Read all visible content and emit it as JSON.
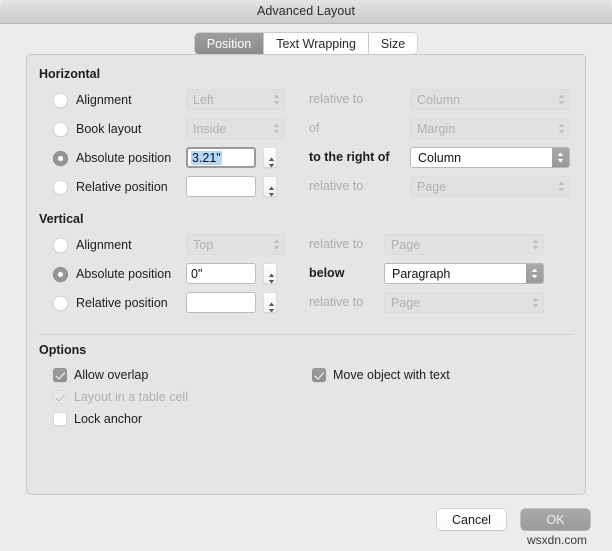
{
  "window": {
    "title": "Advanced Layout"
  },
  "tabs": [
    {
      "label": "Position",
      "selected": true
    },
    {
      "label": "Text Wrapping",
      "selected": false
    },
    {
      "label": "Size",
      "selected": false
    }
  ],
  "horizontal": {
    "title": "Horizontal",
    "rows": [
      {
        "radio_label": "Alignment",
        "selected": false,
        "control_type": "combo",
        "control_value": "Left",
        "control_enabled": false,
        "mid_label": "relative to",
        "mid_active": false,
        "right_value": "Column",
        "right_enabled": false
      },
      {
        "radio_label": "Book layout",
        "selected": false,
        "control_type": "combo",
        "control_value": "Inside",
        "control_enabled": false,
        "mid_label": "of",
        "mid_active": false,
        "right_value": "Margin",
        "right_enabled": false
      },
      {
        "radio_label": "Absolute position",
        "selected": true,
        "control_type": "text",
        "control_value": "3.21\"",
        "control_enabled": true,
        "mid_label": "to the right of",
        "mid_active": true,
        "right_value": "Column",
        "right_enabled": true
      },
      {
        "radio_label": "Relative position",
        "selected": false,
        "control_type": "text",
        "control_value": "",
        "control_enabled": true,
        "mid_label": "relative to",
        "mid_active": false,
        "right_value": "Page",
        "right_enabled": false
      }
    ]
  },
  "vertical": {
    "title": "Vertical",
    "rows": [
      {
        "radio_label": "Alignment",
        "selected": false,
        "control_type": "combo",
        "control_value": "Top",
        "control_enabled": false,
        "mid_label": "relative to",
        "mid_active": false,
        "right_value": "Page",
        "right_enabled": false
      },
      {
        "radio_label": "Absolute position",
        "selected": true,
        "control_type": "text",
        "control_value": "0\"",
        "control_enabled": true,
        "mid_label": "below",
        "mid_active": true,
        "right_value": "Paragraph",
        "right_enabled": true
      },
      {
        "radio_label": "Relative position",
        "selected": false,
        "control_type": "text",
        "control_value": "",
        "control_enabled": true,
        "mid_label": "relative to",
        "mid_active": false,
        "right_value": "Page",
        "right_enabled": false
      }
    ]
  },
  "options": {
    "title": "Options",
    "left_column": [
      {
        "label": "Allow overlap",
        "checked": true,
        "enabled": true
      },
      {
        "label": "Layout in a table cell",
        "checked": true,
        "enabled": false
      },
      {
        "label": "Lock anchor",
        "checked": false,
        "enabled": true
      }
    ],
    "right_column": [
      {
        "label": "Move object with text",
        "checked": true,
        "enabled": true
      }
    ]
  },
  "footer": {
    "cancel_label": "Cancel",
    "ok_label": "OK",
    "watermark": "wsxdn.com"
  },
  "colors": {
    "window_bg": "#ececec",
    "panel_bg": "#e5e5e5",
    "selection_highlight": "#b3d7f7",
    "control_gray": "#9a9a9a",
    "disabled_text": "#b1b1b1"
  }
}
